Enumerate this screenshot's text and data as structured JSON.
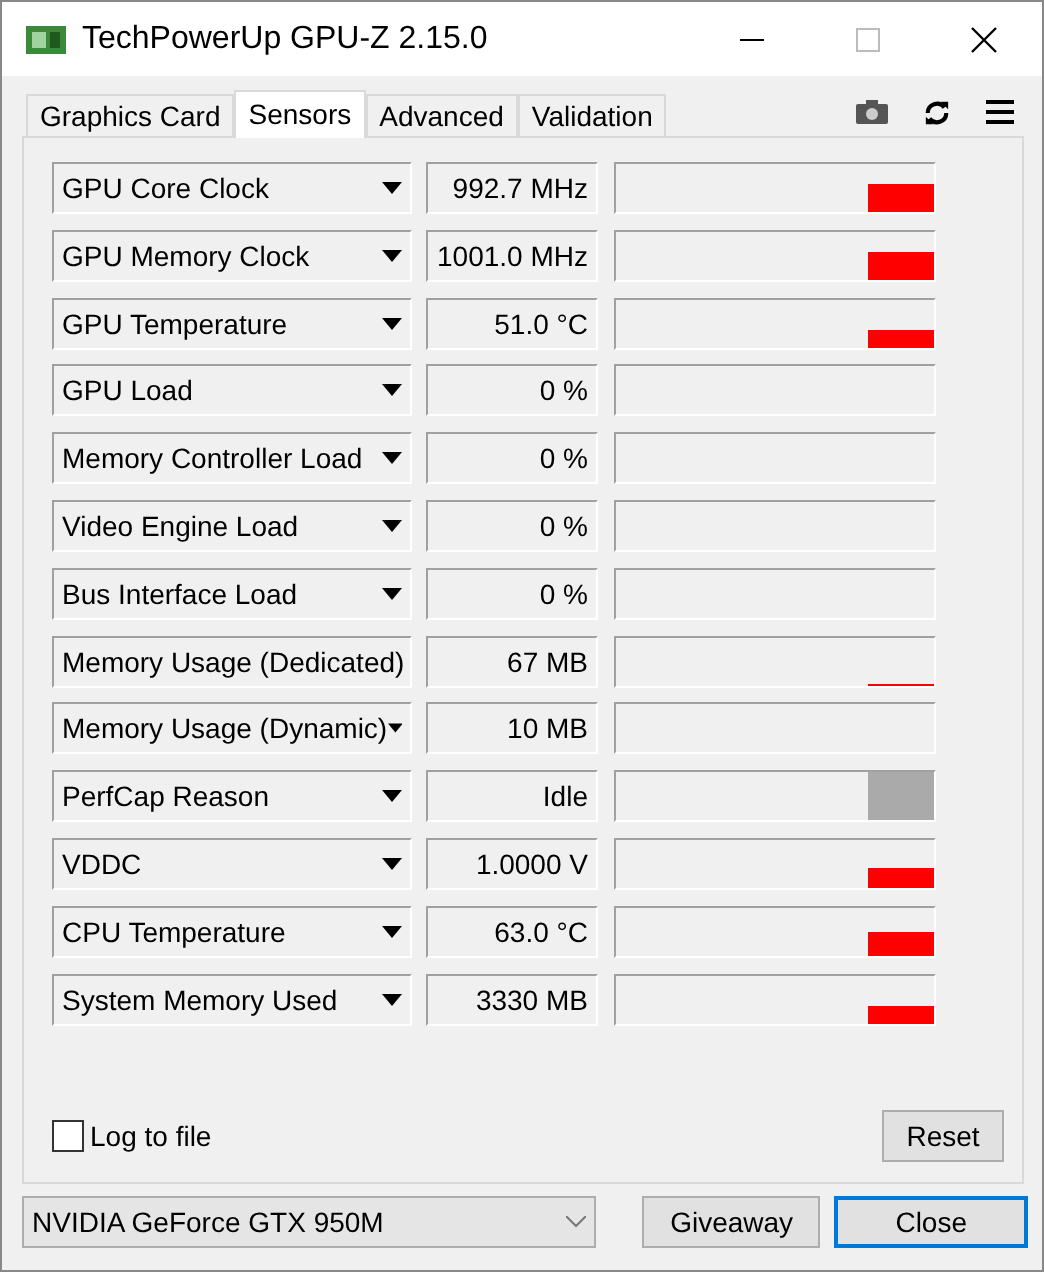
{
  "window": {
    "title": "TechPowerUp GPU-Z 2.15.0"
  },
  "tabs": [
    {
      "label": "Graphics Card",
      "selected": false
    },
    {
      "label": "Sensors",
      "selected": true
    },
    {
      "label": "Advanced",
      "selected": false
    },
    {
      "label": "Validation",
      "selected": false
    }
  ],
  "sensors": [
    {
      "name": "GPU Core Clock",
      "reading": "992.7 MHz"
    },
    {
      "name": "GPU Memory Clock",
      "reading": "1001.0 MHz"
    },
    {
      "name": "GPU Temperature",
      "reading": "51.0 °C"
    },
    {
      "name": "GPU Load",
      "reading": "0 %"
    },
    {
      "name": "Memory Controller Load",
      "reading": "0 %"
    },
    {
      "name": "Video Engine Load",
      "reading": "0 %"
    },
    {
      "name": "Bus Interface Load",
      "reading": "0 %"
    },
    {
      "name": "Memory Usage (Dedicated)",
      "reading": "67 MB"
    },
    {
      "name": "Memory Usage (Dynamic)",
      "reading": "10 MB"
    },
    {
      "name": "PerfCap Reason",
      "reading": "Idle"
    },
    {
      "name": "VDDC",
      "reading": "1.0000 V"
    },
    {
      "name": "CPU Temperature",
      "reading": "63.0 °C"
    },
    {
      "name": "System Memory Used",
      "reading": "3330 MB"
    }
  ],
  "log_to_file": {
    "label": "Log to file",
    "checked": false
  },
  "reset_button": "Reset",
  "gpu_select": {
    "value": "NVIDIA GeForce GTX 950M"
  },
  "buttons": [
    "Giveaway",
    "Close"
  ]
}
